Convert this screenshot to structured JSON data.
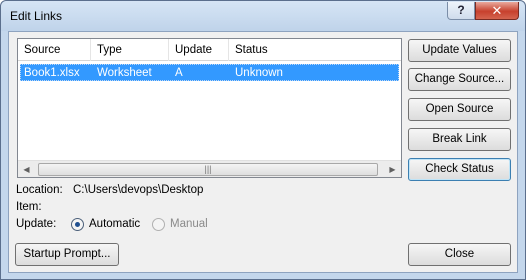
{
  "window": {
    "title": "Edit Links",
    "help_glyph": "?",
    "close_glyph": "✕"
  },
  "links_table": {
    "columns": [
      "Source",
      "Type",
      "Update",
      "Status"
    ],
    "rows": [
      {
        "source": "Book1.xlsx",
        "type": "Worksheet",
        "update": "A",
        "status": "Unknown",
        "selected": true
      }
    ],
    "scroll_grip": "|||"
  },
  "buttons": {
    "update_values": "Update Values",
    "change_source": "Change Source...",
    "open_source": "Open Source",
    "break_link": "Break Link",
    "check_status": "Check Status",
    "startup_prompt": "Startup Prompt...",
    "close": "Close"
  },
  "info": {
    "location_label": "Location:",
    "location_value": "C:\\Users\\devops\\Desktop",
    "item_label": "Item:",
    "item_value": "",
    "update_label": "Update:",
    "automatic_label": "Automatic",
    "manual_label": "Manual",
    "selected_mode": "Automatic"
  },
  "colors": {
    "selection": "#3399ff",
    "title_bar": "#c4d7ec",
    "close_button": "#c7402d"
  }
}
